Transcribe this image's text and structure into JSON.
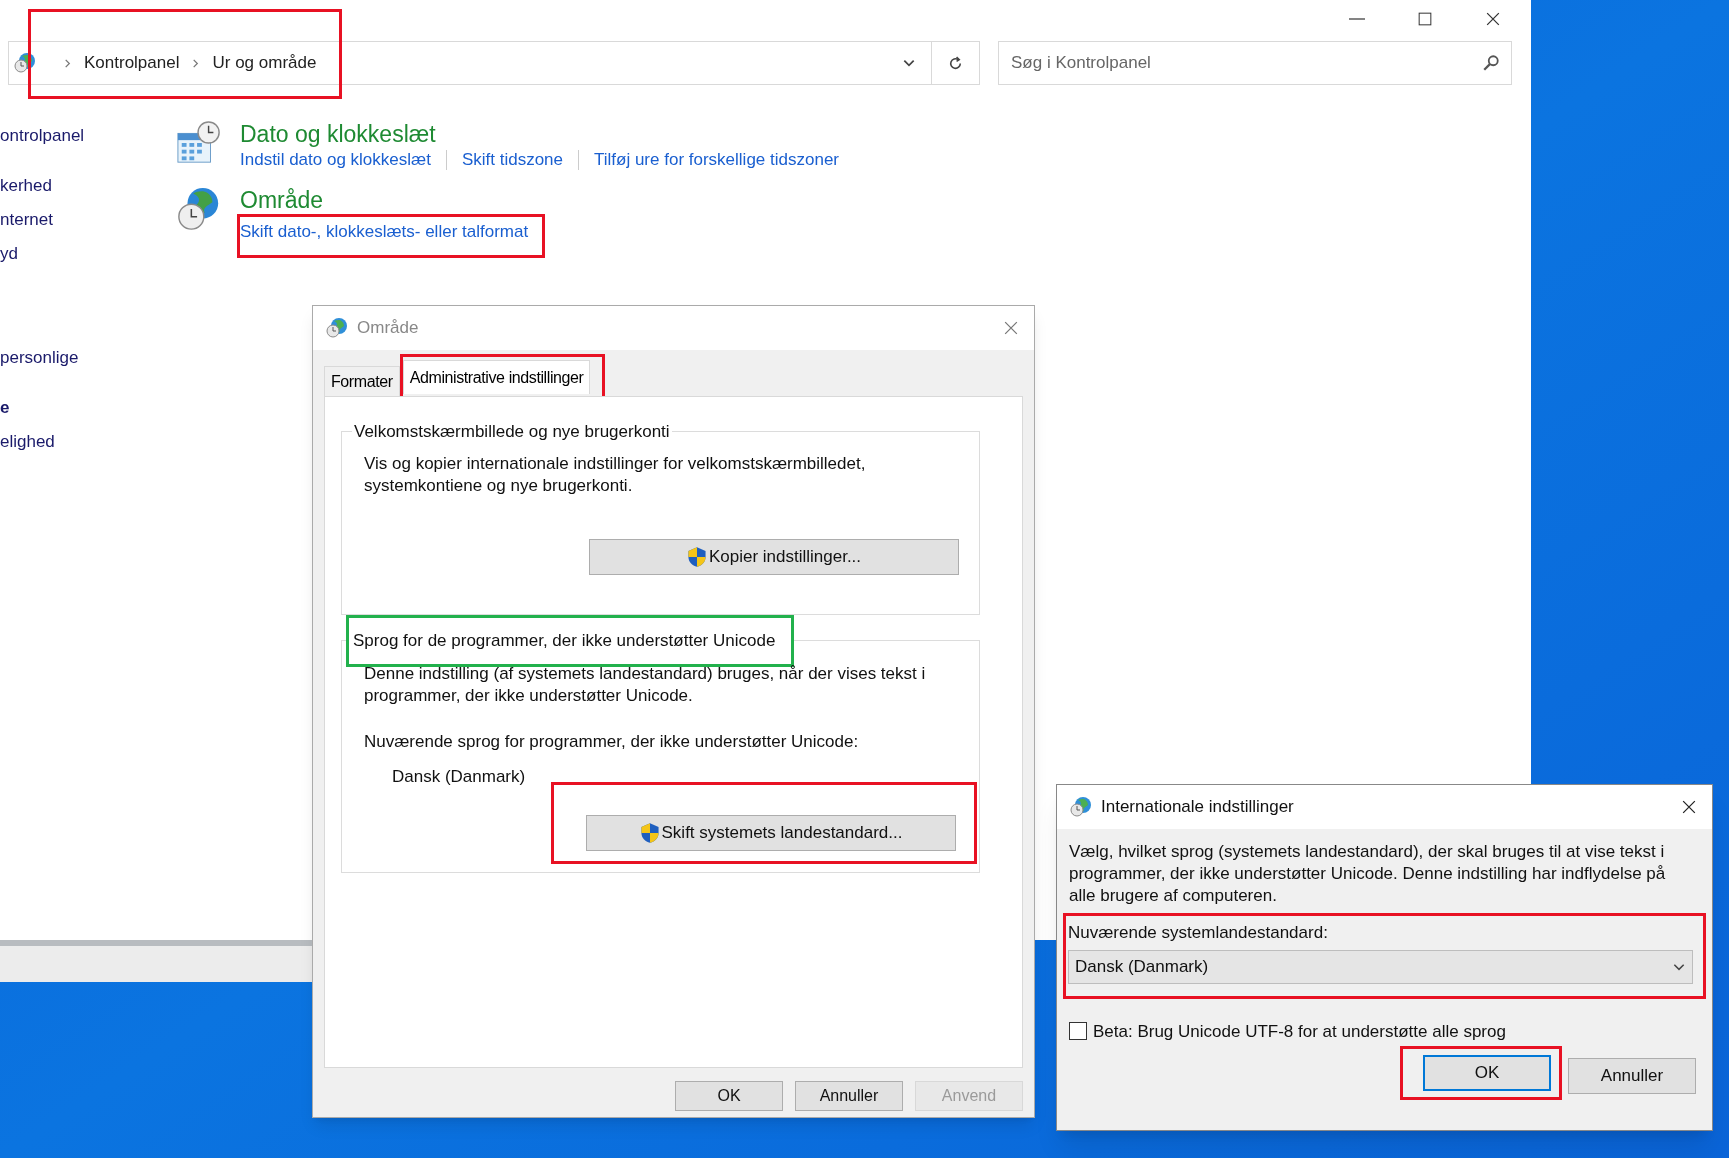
{
  "main_window": {
    "address_bar": {
      "breadcrumb": [
        "Kontrolpanel",
        "Ur og område"
      ],
      "annotation": {
        "color": "#e81123"
      }
    },
    "search": {
      "placeholder": "Søg i Kontrolpanel"
    },
    "sidebar": {
      "items": [
        {
          "label": "ontrolpanel",
          "bold": false
        },
        {
          "label": "kerhed",
          "bold": false
        },
        {
          "label": "nternet",
          "bold": false
        },
        {
          "label": "yd",
          "bold": false
        },
        {
          "label": "personlige",
          "bold": false
        },
        {
          "label": "e",
          "bold": true
        },
        {
          "label": "elighed",
          "bold": false
        }
      ]
    },
    "categories": [
      {
        "title": "Dato og klokkeslæt",
        "kind": "datetime",
        "links": [
          {
            "label": "Indstil dato og klokkeslæt"
          },
          {
            "label": "Skift tidszone"
          },
          {
            "label": "Tilføj ure for forskellige tidszoner"
          }
        ]
      },
      {
        "title": "Område",
        "kind": "region",
        "links": [
          {
            "label": "Skift dato-, klokkeslæts- eller talformat",
            "annotation": {
              "color": "#e81123"
            }
          }
        ]
      }
    ]
  },
  "region_dialog": {
    "title": "Område",
    "active": false,
    "tabs": [
      {
        "label": "Formater",
        "selected": false
      },
      {
        "label": "Administrative indstillinger",
        "selected": true,
        "annotation": {
          "color": "#e81123"
        }
      }
    ],
    "groups": [
      {
        "title": "Velkomstskærmbillede og nye brugerkonti",
        "description": "Vis og kopier internationale indstillinger for velkomstskærmbilledet, systemkontiene og nye brugerkonti.",
        "button": {
          "label": "Kopier indstillinger..."
        }
      },
      {
        "title": "Sprog for de programmer, der ikke understøtter Unicode",
        "title_annotation": {
          "color": "#22b14c"
        },
        "description": "Denne indstilling (af systemets landestandard) bruges, når der vises tekst i programmer, der ikke understøtter Unicode.",
        "current_label": "Nuværende sprog for programmer, der ikke understøtter Unicode:",
        "current_value": "Dansk (Danmark)",
        "button": {
          "label": "Skift systemets landestandard...",
          "annotation": {
            "color": "#e81123"
          }
        }
      }
    ],
    "buttons": [
      {
        "label": "OK",
        "disabled": false
      },
      {
        "label": "Annuller",
        "disabled": false
      },
      {
        "label": "Anvend",
        "disabled": true
      }
    ]
  },
  "intl_dialog": {
    "title": "Internationale indstillinger",
    "active": true,
    "description": "Vælg, hvilket sprog (systemets landestandard), der skal bruges til at vise tekst i programmer, der ikke understøtter Unicode. Denne indstilling har indflydelse på alle brugere af computeren.",
    "locale": {
      "label": "Nuværende systemlandestandard:",
      "value": "Dansk (Danmark)",
      "annotation": {
        "color": "#e81123"
      }
    },
    "beta": {
      "label": "Beta: Brug Unicode UTF-8 for at understøtte alle sprog",
      "checked": false
    },
    "buttons": [
      {
        "label": "OK",
        "default": true,
        "annotation": {
          "color": "#e81123"
        }
      },
      {
        "label": "Annuller",
        "default": false
      }
    ]
  }
}
